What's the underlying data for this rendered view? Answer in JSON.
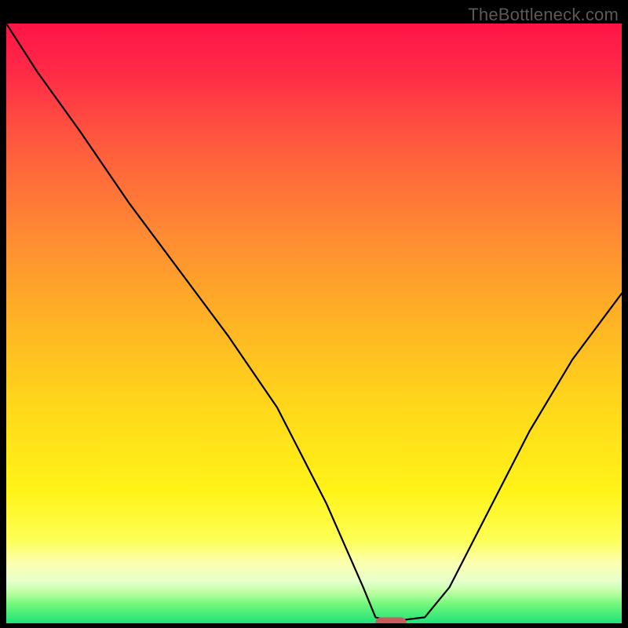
{
  "watermark": "TheBottleneck.com",
  "colors": {
    "background": "#000000",
    "curve": "#000000",
    "marker": "#c95b5f"
  },
  "chart_data": {
    "type": "line",
    "title": "",
    "xlabel": "",
    "ylabel": "",
    "xlim": [
      0,
      100
    ],
    "ylim": [
      0,
      100
    ],
    "grid": false,
    "series": [
      {
        "name": "bottleneck-curve",
        "x": [
          0,
          5,
          12,
          20,
          28,
          36,
          44,
          52,
          58,
          60,
          62,
          64,
          68,
          72,
          78,
          85,
          92,
          100
        ],
        "y": [
          100,
          92,
          82,
          70,
          59,
          48,
          36,
          20,
          6,
          1,
          0.5,
          0.5,
          1,
          6,
          18,
          32,
          44,
          55
        ]
      }
    ],
    "marker": {
      "x_start": 60,
      "x_end": 65,
      "y": 0.2,
      "height": 1.5
    }
  }
}
